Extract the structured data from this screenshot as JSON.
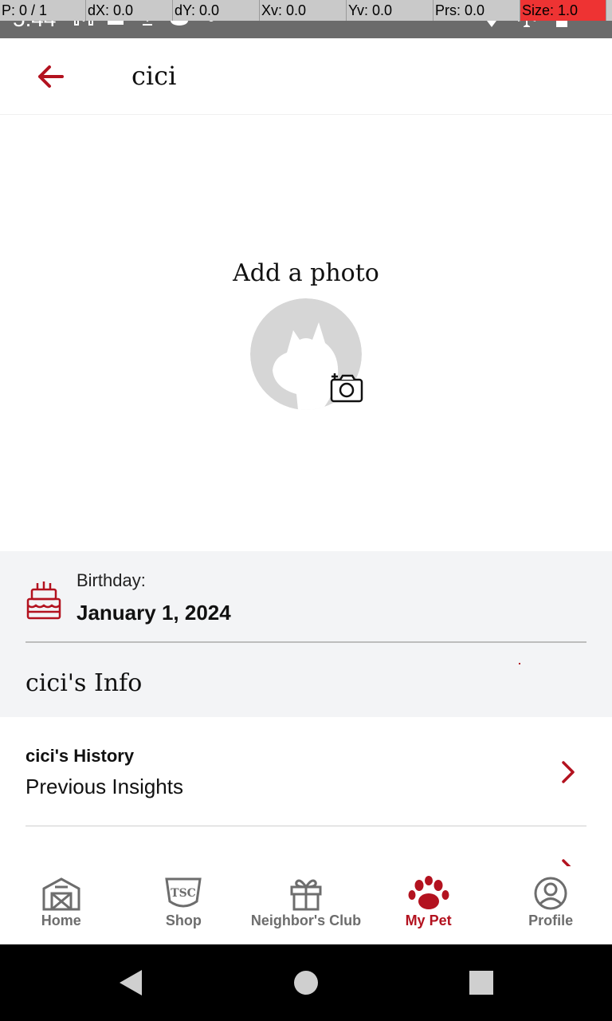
{
  "status_bar": {
    "time": "5:44",
    "debug": {
      "p": "P: 0 / 1",
      "dx": "dX: 0.0",
      "dy": "dY: 0.0",
      "xv": "Xv: 0.0",
      "yv": "Yv: 0.0",
      "prs": "Prs: 0.0",
      "size": "Size: 1.0"
    }
  },
  "header": {
    "title": "cici",
    "back_icon": "arrow-left-icon"
  },
  "photo": {
    "label": "Add a photo",
    "avatar_icon": "cat-silhouette-icon",
    "camera_icon": "add-camera-icon"
  },
  "birthday": {
    "label": "Birthday:",
    "value": "January 1, 2024",
    "icon": "cake-icon"
  },
  "info": {
    "title": "cici's Info"
  },
  "list": [
    {
      "title": "cici's History",
      "subtitle": "Previous Insights"
    }
  ],
  "bottom_nav": {
    "items": [
      {
        "label": "Home",
        "icon": "barn-icon"
      },
      {
        "label": "Shop",
        "icon": "tsc-shop-icon"
      },
      {
        "label": "Neighbor's Club",
        "icon": "gift-icon"
      },
      {
        "label": "My Pet",
        "icon": "paw-icon"
      },
      {
        "label": "Profile",
        "icon": "profile-icon"
      }
    ],
    "active_index": 3
  },
  "colors": {
    "brand_red": "#b3121f",
    "inactive_gray": "#6d6d6d",
    "section_gray": "#f3f4f6"
  }
}
